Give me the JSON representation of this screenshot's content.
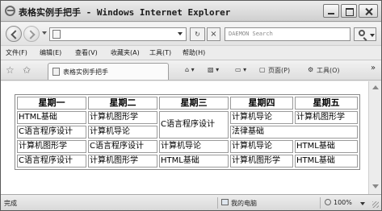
{
  "window": {
    "title": "表格实例手把手 - Windows Internet Explorer"
  },
  "address_bar": {
    "url": "",
    "search_placeholder": "DAEMON Search"
  },
  "menu": [
    {
      "label": "文件(F)"
    },
    {
      "label": "编辑(E)"
    },
    {
      "label": "查看(V)"
    },
    {
      "label": "收藏夹(A)"
    },
    {
      "label": "工具(T)"
    },
    {
      "label": "帮助(H)"
    }
  ],
  "tab": {
    "label": "表格实例手把手"
  },
  "command_bar": {
    "page_label": "页面(P)",
    "tools_label": "工具(O)"
  },
  "schedule": {
    "headers": [
      "星期一",
      "星期二",
      "星期三",
      "星期四",
      "星期五"
    ],
    "rows": [
      [
        "HTML基础",
        "计算机图形学",
        "C语言程序设计",
        "计算机导论",
        "计算机图形学"
      ],
      [
        "C语言程序设计",
        "计算机导论",
        "法律基础"
      ],
      [
        "计算机图形学",
        "C语言程序设计",
        "计算机导论",
        "计算机导论",
        "HTML基础"
      ],
      [
        "C语言程序设计",
        "计算机图形学",
        "HTML基础",
        "计算机图形学",
        "HTML基础"
      ]
    ]
  },
  "status_bar": {
    "status": "完成",
    "zone": "我的电脑",
    "zoom": "100%"
  },
  "icons": [
    "ie-logo-icon",
    "back-arrow-icon",
    "forward-arrow-icon",
    "page-icon",
    "refresh-icon",
    "stop-icon",
    "search-icon",
    "favorites-star-icon",
    "add-favorites-icon",
    "home-icon",
    "feeds-icon",
    "print-icon",
    "page-menu-icon",
    "tools-gear-icon",
    "my-computer-icon",
    "zoom-icon"
  ]
}
